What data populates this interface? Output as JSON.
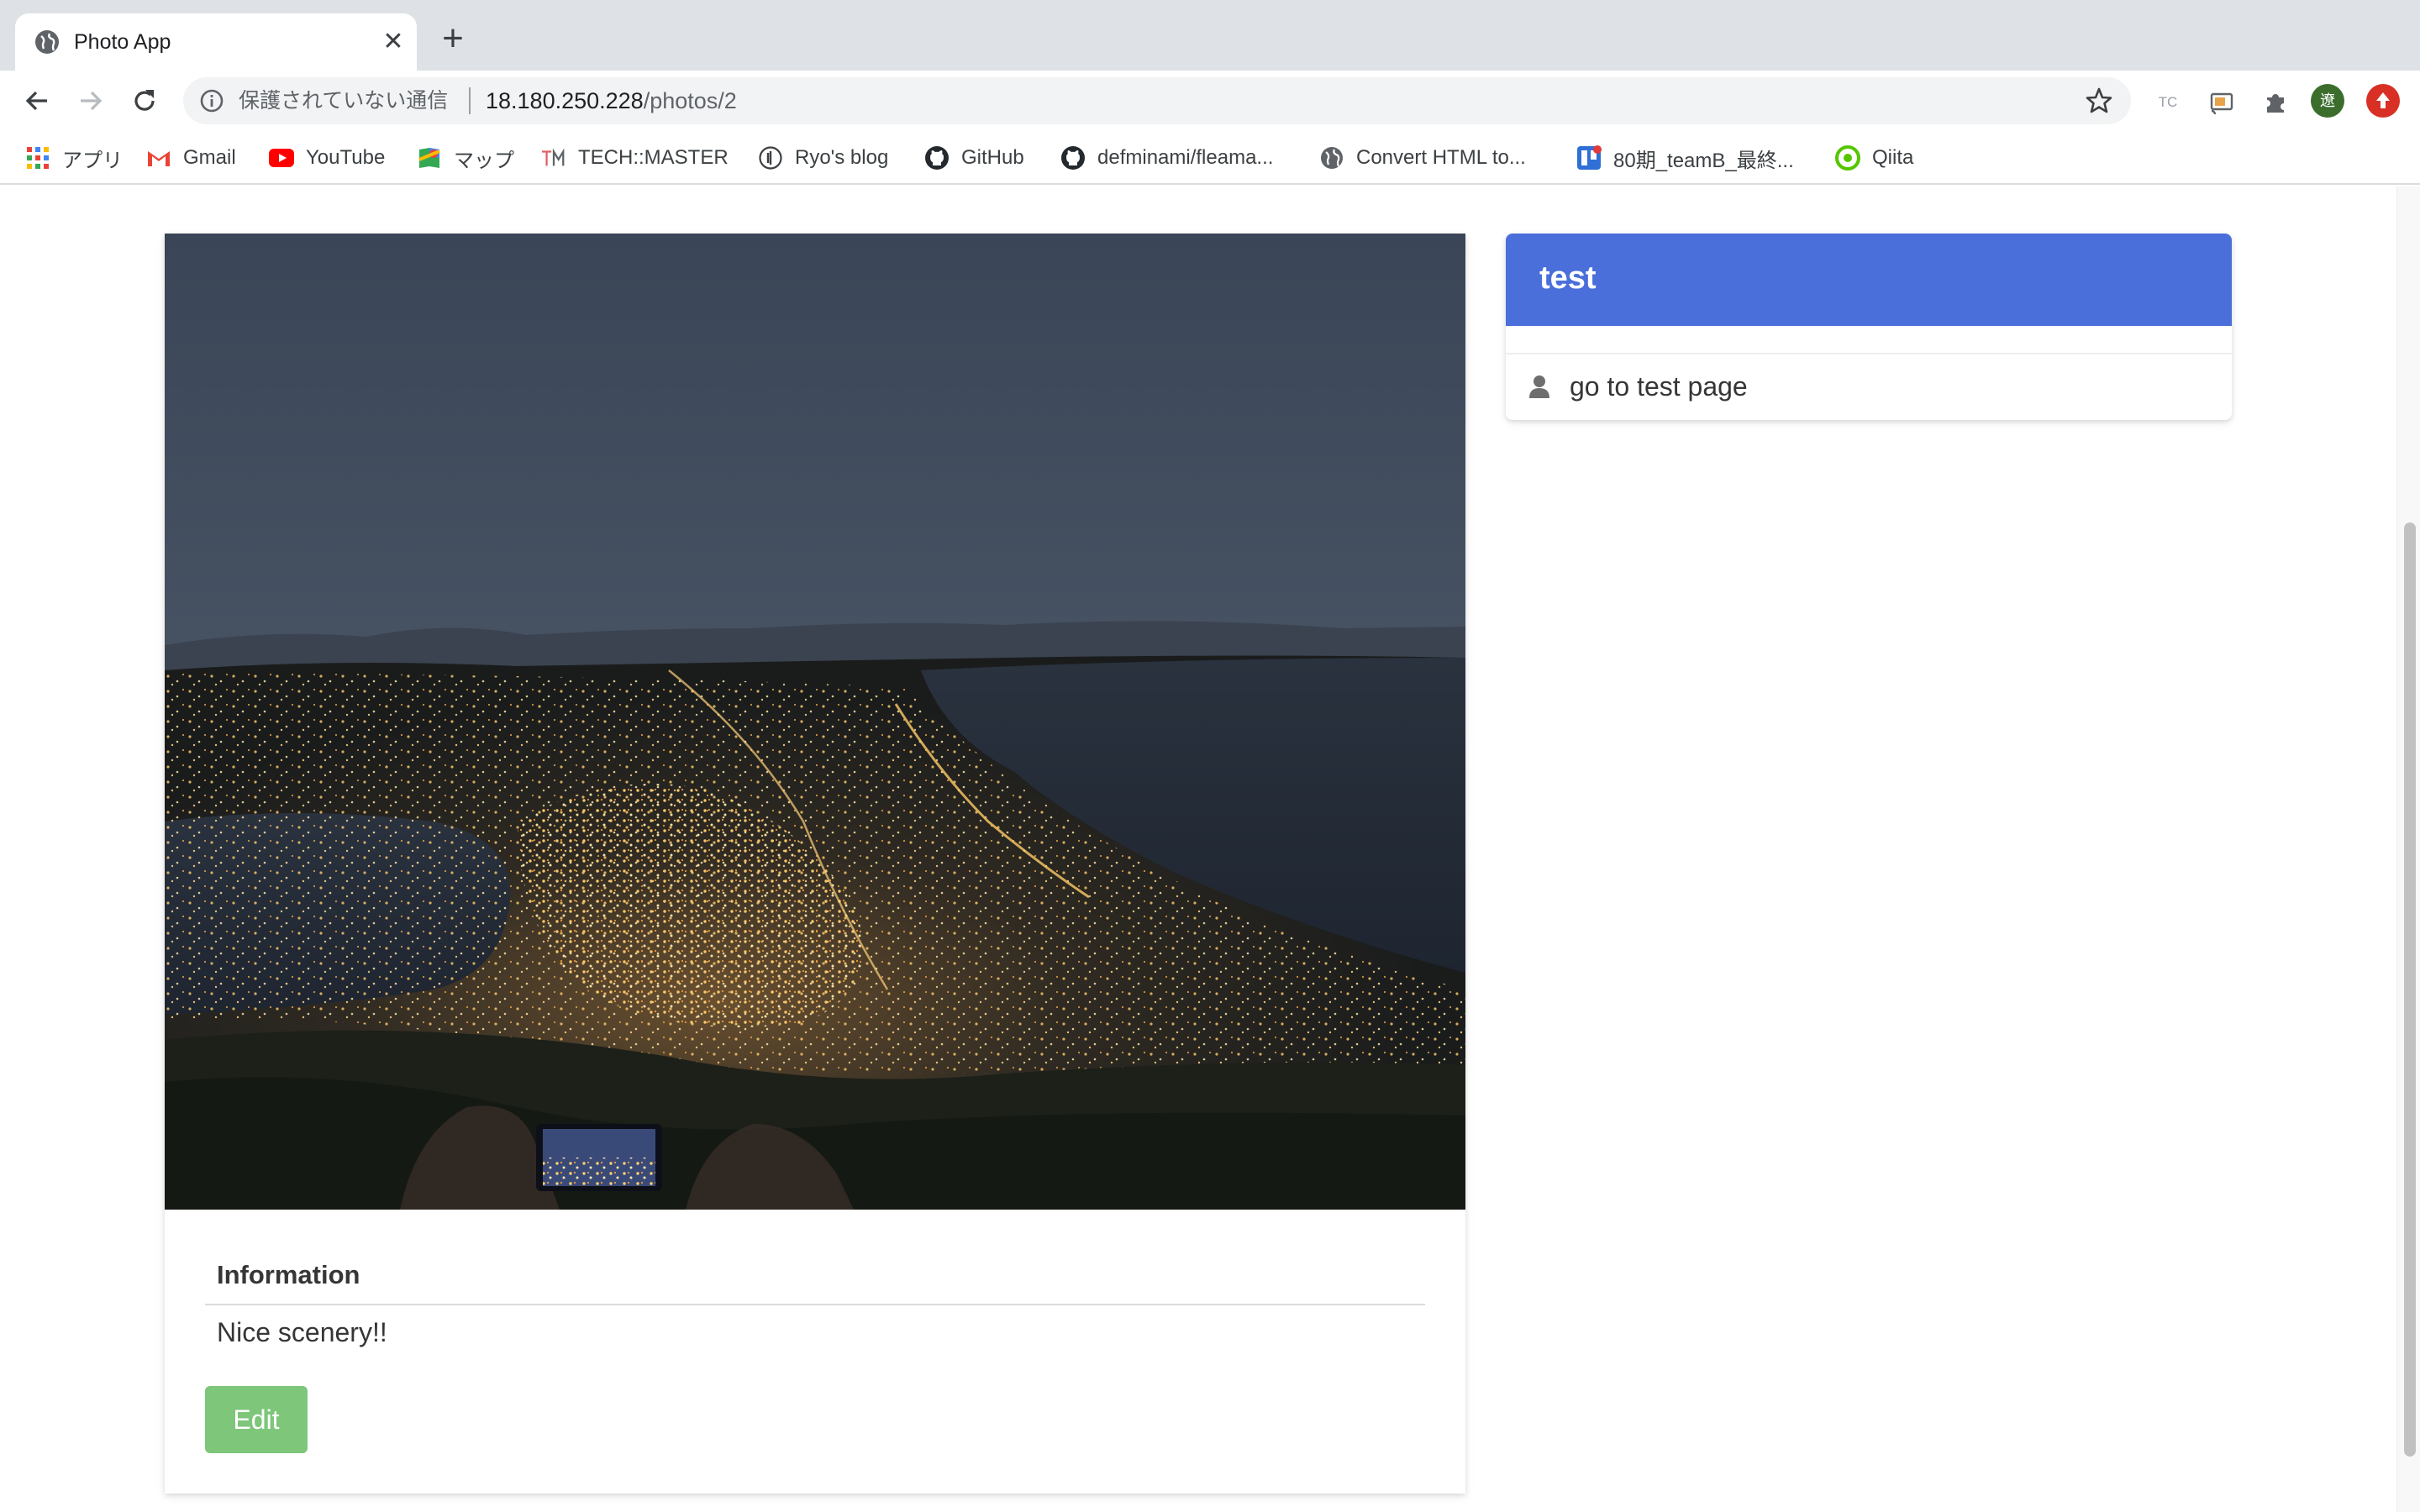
{
  "browser": {
    "tab_title": "Photo App",
    "tab_close": "✕",
    "new_tab": "+",
    "secure_label": "保護されていない通信",
    "url_host": "18.180.250.228",
    "url_path": "/photos/2",
    "avatar_letter": "遼",
    "ext_tc": "TC"
  },
  "bookmarks": [
    {
      "label": "アプリ",
      "icon": "apps-grid-icon"
    },
    {
      "label": "Gmail",
      "icon": "gmail-icon"
    },
    {
      "label": "YouTube",
      "icon": "youtube-icon"
    },
    {
      "label": "マップ",
      "icon": "maps-icon"
    },
    {
      "label": "TECH::MASTER",
      "icon": "techmaster-icon"
    },
    {
      "label": "Ryo's blog",
      "icon": "blog-icon"
    },
    {
      "label": "GitHub",
      "icon": "github-icon"
    },
    {
      "label": "defminami/fleama...",
      "icon": "github-icon"
    },
    {
      "label": "Convert HTML to...",
      "icon": "globe-icon"
    },
    {
      "label": "80期_teamB_最終...",
      "icon": "trello-icon"
    },
    {
      "label": "Qiita",
      "icon": "qiita-icon"
    }
  ],
  "photo_card": {
    "info_heading": "Information",
    "info_text": "Nice scenery!!",
    "edit_label": "Edit"
  },
  "user_card": {
    "name": "test",
    "link_label": "go to test page"
  },
  "colors": {
    "header_blue": "#4a6fdb",
    "edit_green": "#7dc67a"
  }
}
